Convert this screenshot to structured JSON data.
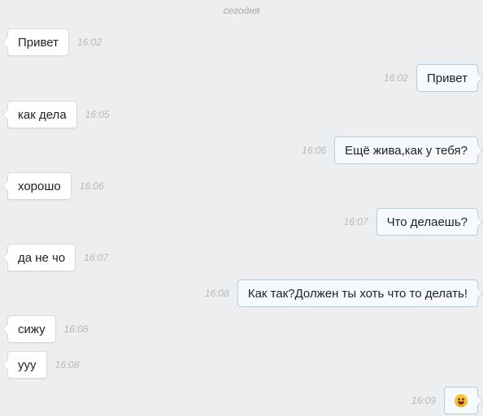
{
  "chat": {
    "date_label": "сегодня",
    "messages": [
      {
        "direction": "in",
        "text": "Привет",
        "time": "16:02"
      },
      {
        "direction": "out",
        "text": "Привет",
        "time": "16:02"
      },
      {
        "direction": "in",
        "text": "как дела",
        "time": "16:05"
      },
      {
        "direction": "out",
        "text": "Ещё жива,как у тебя?",
        "time": "16:06"
      },
      {
        "direction": "in",
        "text": "хорошо",
        "time": "16:06"
      },
      {
        "direction": "out",
        "text": "Что делаешь?",
        "time": "16:07"
      },
      {
        "direction": "in",
        "text": "да не чо",
        "time": "16:07"
      },
      {
        "direction": "out",
        "text": "Как так?Должен ты хоть что то делать!",
        "time": "16:08"
      },
      {
        "direction": "in",
        "text": "сижу",
        "time": "16:08"
      },
      {
        "direction": "in",
        "text": "ууу",
        "time": "16:08"
      },
      {
        "direction": "out",
        "text": "",
        "icon": "grinning-face-emoji-icon",
        "time": "16:09"
      }
    ]
  },
  "colors": {
    "background": "#edeef0",
    "incoming_bubble": "#ffffff",
    "outgoing_bubble": "#f7fafc",
    "outgoing_border": "#b6cde0",
    "timestamp": "#b3b8bd"
  }
}
